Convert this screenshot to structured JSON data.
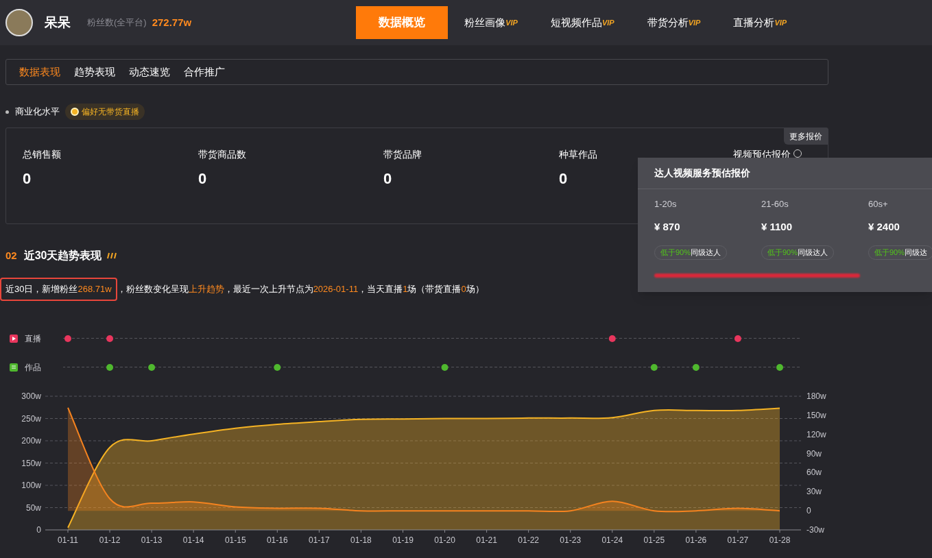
{
  "profile": {
    "name": "呆呆",
    "fans_label": "粉丝数(全平台)",
    "fans_value": "272.77w"
  },
  "nav": [
    {
      "label": "数据概览",
      "selected": true
    },
    {
      "label": "粉丝画像",
      "badge": "VIP",
      "selected": false
    },
    {
      "label": "短视频作品",
      "badge": "VIP",
      "selected": false
    },
    {
      "label": "带货分析",
      "badge": "VIP",
      "selected": false
    },
    {
      "label": "直播分析",
      "badge": "VIP",
      "selected": false
    }
  ],
  "subtabs": [
    {
      "label": "数据表现",
      "selected": true
    },
    {
      "label": "趋势表现",
      "selected": false
    },
    {
      "label": "动态速览",
      "selected": false
    },
    {
      "label": "合作推广",
      "selected": false
    }
  ],
  "commerce": {
    "title": "商业化水平",
    "tag": "偏好无带货直播",
    "more": "更多报价",
    "stats": [
      {
        "label": "总销售额",
        "value": "0"
      },
      {
        "label": "带货商品数",
        "value": "0"
      },
      {
        "label": "带货品牌",
        "value": "0"
      },
      {
        "label": "种草作品",
        "value": "0"
      }
    ],
    "quote_label": "视频预估报价"
  },
  "popover": {
    "title": "达人视频服务预估报价",
    "columns": [
      {
        "range": "1-20s",
        "price": "¥ 870",
        "hint": "低于90%",
        "rest": "同级达人"
      },
      {
        "range": "21-60s",
        "price": "¥ 1100",
        "hint": "低于90%",
        "rest": "同级达人"
      },
      {
        "range": "60s+",
        "price": "¥ 2400",
        "hint": "低于90%",
        "rest": "同级达"
      }
    ]
  },
  "trend": {
    "number": "02",
    "title": "近30天趋势表现",
    "summary": {
      "boxed": [
        {
          "text": "近30日，新增粉丝",
          "highlight": false
        },
        {
          "text": "268.71w",
          "highlight": true
        }
      ],
      "rest": [
        {
          "text": "，粉丝数变化呈现",
          "highlight": false
        },
        {
          "text": "上升趋势",
          "highlight": true
        },
        {
          "text": "，最近一次上升节点为",
          "highlight": false
        },
        {
          "text": "2026-01-11",
          "highlight": true
        },
        {
          "text": "，当天直播",
          "highlight": false
        },
        {
          "text": "1",
          "highlight": true
        },
        {
          "text": "场（带货直播",
          "highlight": false
        },
        {
          "text": "0",
          "highlight": true
        },
        {
          "text": "场）",
          "highlight": false
        }
      ]
    },
    "events": [
      {
        "kind": "live",
        "label": "直播",
        "color": "#e8365d",
        "hits": [
          true,
          true,
          false,
          false,
          false,
          false,
          false,
          false,
          false,
          false,
          false,
          false,
          false,
          true,
          false,
          false,
          true,
          false
        ]
      },
      {
        "kind": "post",
        "label": "作品",
        "color": "#4fb82e",
        "hits": [
          false,
          true,
          true,
          false,
          false,
          true,
          false,
          false,
          false,
          true,
          false,
          false,
          false,
          false,
          true,
          true,
          false,
          true
        ]
      }
    ],
    "fans": {
      "chart_data": {
        "type": "area",
        "grid": true,
        "categories": [
          "01-11",
          "01-12",
          "01-13",
          "01-14",
          "01-15",
          "01-16",
          "01-17",
          "01-18",
          "01-19",
          "01-20",
          "01-21",
          "01-22",
          "01-23",
          "01-24",
          "01-25",
          "01-26",
          "01-27",
          "01-28"
        ],
        "ylim": [
          0,
          300
        ],
        "yticks": [
          {
            "value": 0,
            "label": "0"
          },
          {
            "value": 50,
            "label": "50w"
          },
          {
            "value": 100,
            "label": "100w"
          },
          {
            "value": 150,
            "label": "150w"
          },
          {
            "value": 200,
            "label": "200w"
          },
          {
            "value": 250,
            "label": "250w"
          },
          {
            "value": 300,
            "label": "300w"
          }
        ],
        "y2lim": [
          -30,
          180
        ],
        "y2ticks": [
          {
            "value": -30,
            "label": "-30w"
          },
          {
            "value": 0,
            "label": "0"
          },
          {
            "value": 30,
            "label": "30w"
          },
          {
            "value": 60,
            "label": "60w"
          },
          {
            "value": 90,
            "label": "90w"
          },
          {
            "value": 120,
            "label": "120w"
          },
          {
            "value": 150,
            "label": "150w"
          },
          {
            "value": 180,
            "label": "180w"
          }
        ],
        "series": [
          {
            "color": "#f5b324",
            "values": [
              5,
              185,
              200,
              215,
              228,
              237,
              243,
              248,
              249,
              250,
              250,
              251,
              251,
              252,
              268,
              268,
              268,
              273
            ]
          },
          {
            "axis": "y2",
            "color": "#f5831f",
            "values": [
              162,
              19,
              12,
              14,
              6,
              4,
              4,
              0,
              0,
              0,
              0,
              0,
              0,
              15,
              0,
              0,
              4,
              0
            ]
          }
        ]
      }
    }
  }
}
